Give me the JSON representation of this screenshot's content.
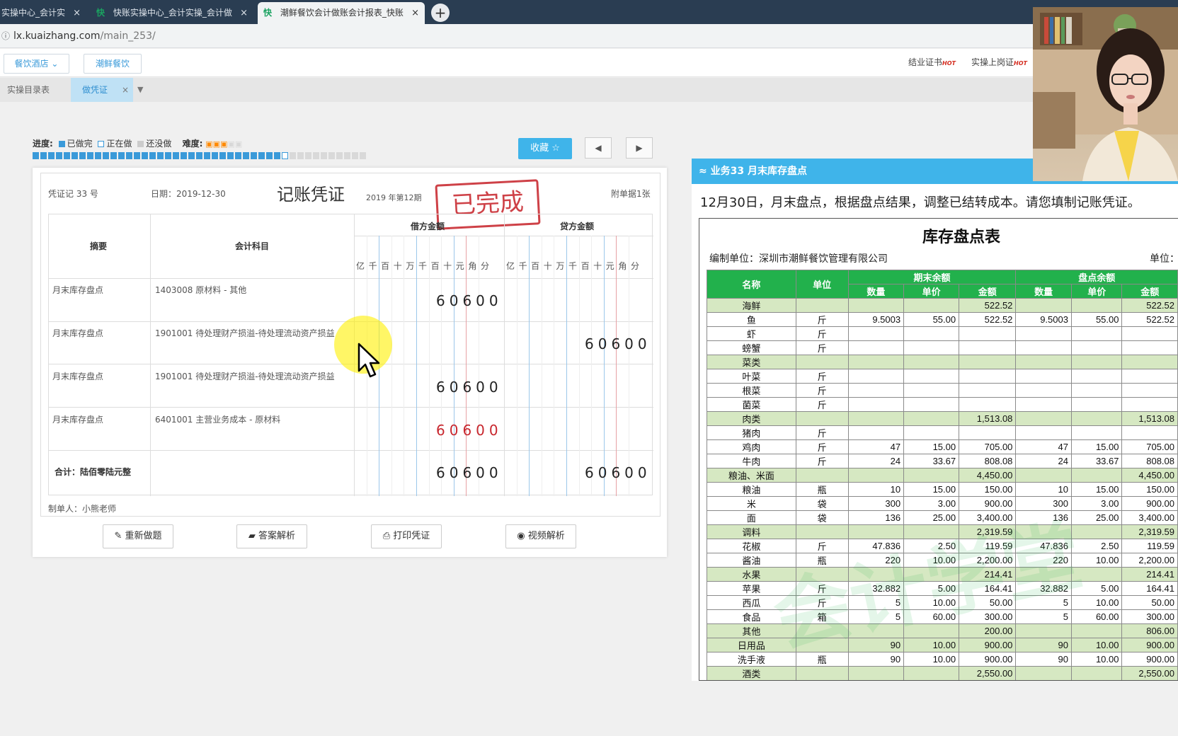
{
  "browser": {
    "tabs": [
      {
        "label": "实操中心_会计实",
        "close": "×"
      },
      {
        "label": "快账实操中心_会计实操_会计做",
        "close": "×",
        "favicon": "快"
      },
      {
        "label": "潮鲜餐饮会计做账会计报表_快账",
        "close": "×",
        "favicon": "快"
      }
    ],
    "new_tab": "+",
    "url_host": "lx.kuaizhang.com",
    "url_path": "/main_253/"
  },
  "header": {
    "industry_select": "餐饮酒店",
    "company_button": "潮鲜餐饮",
    "link_cert": "结业证书",
    "link_job_cert": "实操上岗证",
    "hot_badge": "HOT"
  },
  "subtabs": {
    "catalog": "实操目录表",
    "voucher_tab": "做凭证",
    "close": "×",
    "dropdown": "▼"
  },
  "progress": {
    "label": "进度:",
    "legend_done": "已做完",
    "legend_doing": "正在做",
    "legend_todo": "还没做",
    "difficulty_label": "难度:",
    "difficulty_stars": 3,
    "difficulty_max": 5,
    "total_segments": 43,
    "completed_segments": 32,
    "current_segment": 33
  },
  "actions": {
    "favorite": "收藏 ☆",
    "prev": "◀",
    "next": "▶"
  },
  "voucher": {
    "number": "凭证记 33 号",
    "date": "日期：2019-12-30",
    "title": "记账凭证",
    "period": "2019 年第12期",
    "attachments": "附单据1张",
    "stamp": "已完成",
    "col_summary": "摘要",
    "col_account": "会计科目",
    "col_debit": "借方金额",
    "col_credit": "贷方金额",
    "digit_headers": [
      "亿",
      "千",
      "百",
      "十",
      "万",
      "千",
      "百",
      "十",
      "元",
      "角",
      "分"
    ],
    "rows": [
      {
        "summary": "月末库存盘点",
        "account": "1403008 原材料 - 其他",
        "debit": "60600",
        "credit": "",
        "debit_red": false
      },
      {
        "summary": "月末库存盘点",
        "account": "1901001 待处理财产损溢-待处理流动资产损益",
        "debit": "",
        "credit": "60600",
        "debit_red": false
      },
      {
        "summary": "月末库存盘点",
        "account": "1901001 待处理财产损溢-待处理流动资产损益",
        "debit": "60600",
        "credit": "",
        "debit_red": false
      },
      {
        "summary": "月末库存盘点",
        "account": "6401001 主营业务成本 - 原材料",
        "debit": "60600",
        "credit": "",
        "debit_red": true
      }
    ],
    "total_label": "合计：陆佰零陆元整",
    "total_debit": "60600",
    "total_credit": "60600",
    "maker": "制单人：小熊老师"
  },
  "buttons": {
    "redo": "✎ 重新做题",
    "answer": "▰ 答案解析",
    "print": "⎙ 打印凭证",
    "video": "◉ 视频解析"
  },
  "task": {
    "header": "≈ 业务33 月末库存盘点",
    "description": "12月30日，月末盘点，根据盘点结果，调整已结转成本。请您填制记账凭证。"
  },
  "inventory": {
    "title": "库存盘点表",
    "unit_company": "编制单位：深圳市潮鲜餐饮管理有限公司",
    "unit_label": "单位：",
    "headers": {
      "name": "名称",
      "unit": "单位",
      "period_end": "期末余额",
      "count": "盘点余额",
      "qty": "数量",
      "price": "单价",
      "amount": "金额"
    },
    "rows": [
      {
        "name": "海鲜",
        "unit": "",
        "q1": "",
        "p1": "",
        "a1": "522.52",
        "q2": "",
        "p2": "",
        "a2": "522.52",
        "cat": true
      },
      {
        "name": "鱼",
        "unit": "斤",
        "q1": "9.5003",
        "p1": "55.00",
        "a1": "522.52",
        "q2": "9.5003",
        "p2": "55.00",
        "a2": "522.52",
        "cat": false
      },
      {
        "name": "虾",
        "unit": "斤",
        "q1": "",
        "p1": "",
        "a1": "",
        "q2": "",
        "p2": "",
        "a2": "",
        "cat": false
      },
      {
        "name": "螃蟹",
        "unit": "斤",
        "q1": "",
        "p1": "",
        "a1": "",
        "q2": "",
        "p2": "",
        "a2": "",
        "cat": false
      },
      {
        "name": "菜类",
        "unit": "",
        "q1": "",
        "p1": "",
        "a1": "",
        "q2": "",
        "p2": "",
        "a2": "",
        "cat": true
      },
      {
        "name": "叶菜",
        "unit": "斤",
        "q1": "",
        "p1": "",
        "a1": "",
        "q2": "",
        "p2": "",
        "a2": "",
        "cat": false
      },
      {
        "name": "根菜",
        "unit": "斤",
        "q1": "",
        "p1": "",
        "a1": "",
        "q2": "",
        "p2": "",
        "a2": "",
        "cat": false
      },
      {
        "name": "菌菜",
        "unit": "斤",
        "q1": "",
        "p1": "",
        "a1": "",
        "q2": "",
        "p2": "",
        "a2": "",
        "cat": false
      },
      {
        "name": "肉类",
        "unit": "",
        "q1": "",
        "p1": "",
        "a1": "1,513.08",
        "q2": "",
        "p2": "",
        "a2": "1,513.08",
        "cat": true
      },
      {
        "name": "猪肉",
        "unit": "斤",
        "q1": "",
        "p1": "",
        "a1": "",
        "q2": "",
        "p2": "",
        "a2": "",
        "cat": false
      },
      {
        "name": "鸡肉",
        "unit": "斤",
        "q1": "47",
        "p1": "15.00",
        "a1": "705.00",
        "q2": "47",
        "p2": "15.00",
        "a2": "705.00",
        "cat": false
      },
      {
        "name": "牛肉",
        "unit": "斤",
        "q1": "24",
        "p1": "33.67",
        "a1": "808.08",
        "q2": "24",
        "p2": "33.67",
        "a2": "808.08",
        "cat": false
      },
      {
        "name": "粮油、米面",
        "unit": "",
        "q1": "",
        "p1": "",
        "a1": "4,450.00",
        "q2": "",
        "p2": "",
        "a2": "4,450.00",
        "cat": true
      },
      {
        "name": "粮油",
        "unit": "瓶",
        "q1": "10",
        "p1": "15.00",
        "a1": "150.00",
        "q2": "10",
        "p2": "15.00",
        "a2": "150.00",
        "cat": false
      },
      {
        "name": "米",
        "unit": "袋",
        "q1": "300",
        "p1": "3.00",
        "a1": "900.00",
        "q2": "300",
        "p2": "3.00",
        "a2": "900.00",
        "cat": false
      },
      {
        "name": "面",
        "unit": "袋",
        "q1": "136",
        "p1": "25.00",
        "a1": "3,400.00",
        "q2": "136",
        "p2": "25.00",
        "a2": "3,400.00",
        "cat": false
      },
      {
        "name": "调料",
        "unit": "",
        "q1": "",
        "p1": "",
        "a1": "2,319.59",
        "q2": "",
        "p2": "",
        "a2": "2,319.59",
        "cat": true
      },
      {
        "name": "花椒",
        "unit": "斤",
        "q1": "47.836",
        "p1": "2.50",
        "a1": "119.59",
        "q2": "47.836",
        "p2": "2.50",
        "a2": "119.59",
        "cat": false
      },
      {
        "name": "酱油",
        "unit": "瓶",
        "q1": "220",
        "p1": "10.00",
        "a1": "2,200.00",
        "q2": "220",
        "p2": "10.00",
        "a2": "2,200.00",
        "cat": false
      },
      {
        "name": "水果",
        "unit": "",
        "q1": "",
        "p1": "",
        "a1": "214.41",
        "q2": "",
        "p2": "",
        "a2": "214.41",
        "cat": true
      },
      {
        "name": "苹果",
        "unit": "斤",
        "q1": "32.882",
        "p1": "5.00",
        "a1": "164.41",
        "q2": "32.882",
        "p2": "5.00",
        "a2": "164.41",
        "cat": false
      },
      {
        "name": "西瓜",
        "unit": "斤",
        "q1": "5",
        "p1": "10.00",
        "a1": "50.00",
        "q2": "5",
        "p2": "10.00",
        "a2": "50.00",
        "cat": false
      },
      {
        "name": "食品",
        "unit": "箱",
        "q1": "5",
        "p1": "60.00",
        "a1": "300.00",
        "q2": "5",
        "p2": "60.00",
        "a2": "300.00",
        "cat": false
      },
      {
        "name": "其他",
        "unit": "",
        "q1": "",
        "p1": "",
        "a1": "200.00",
        "q2": "",
        "p2": "",
        "a2": "806.00",
        "cat": true
      },
      {
        "name": "日用品",
        "unit": "",
        "q1": "90",
        "p1": "10.00",
        "a1": "900.00",
        "q2": "90",
        "p2": "10.00",
        "a2": "900.00",
        "cat": true
      },
      {
        "name": "洗手液",
        "unit": "瓶",
        "q1": "90",
        "p1": "10.00",
        "a1": "900.00",
        "q2": "90",
        "p2": "10.00",
        "a2": "900.00",
        "cat": false
      },
      {
        "name": "酒类",
        "unit": "",
        "q1": "",
        "p1": "",
        "a1": "2,550.00",
        "q2": "",
        "p2": "",
        "a2": "2,550.00",
        "cat": true
      }
    ],
    "watermark": "会计学堂"
  },
  "colors": {
    "accent_blue": "#3fb4ea",
    "stamp_red": "#c8272e",
    "table_green": "#22b14c",
    "category_row": "#d6e8c2"
  }
}
